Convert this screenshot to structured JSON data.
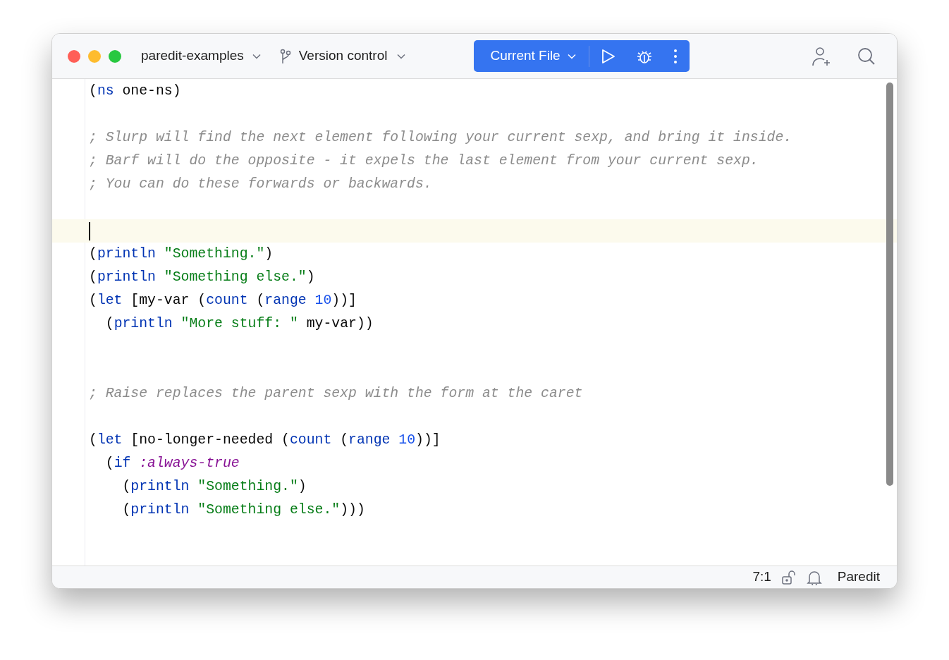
{
  "window": {
    "project": "paredit-examples",
    "vcs": "Version control",
    "run_config": "Current File"
  },
  "editor": {
    "lines": [
      {
        "kind": "code",
        "tokens": [
          {
            "kind": "plain",
            "text": "("
          },
          {
            "kind": "keyword",
            "text": "ns"
          },
          {
            "kind": "plain",
            "text": " one-ns)"
          }
        ]
      },
      {
        "kind": "blank"
      },
      {
        "kind": "code",
        "tokens": [
          {
            "kind": "comment",
            "text": "; Slurp will find the next element following your current sexp, and bring it inside."
          }
        ]
      },
      {
        "kind": "code",
        "tokens": [
          {
            "kind": "comment",
            "text": "; Barf will do the opposite - it expels the last element from your current sexp."
          }
        ]
      },
      {
        "kind": "code",
        "tokens": [
          {
            "kind": "comment",
            "text": "; You can do these forwards or backwards."
          }
        ]
      },
      {
        "kind": "blank"
      },
      {
        "kind": "caret"
      },
      {
        "kind": "code",
        "tokens": [
          {
            "kind": "plain",
            "text": "("
          },
          {
            "kind": "keyword",
            "text": "println"
          },
          {
            "kind": "string",
            "text": " \"Something.\""
          },
          {
            "kind": "plain",
            "text": ")"
          }
        ]
      },
      {
        "kind": "code",
        "tokens": [
          {
            "kind": "plain",
            "text": "("
          },
          {
            "kind": "keyword",
            "text": "println"
          },
          {
            "kind": "string",
            "text": " \"Something else.\""
          },
          {
            "kind": "plain",
            "text": ")"
          }
        ]
      },
      {
        "kind": "code",
        "tokens": [
          {
            "kind": "plain",
            "text": "("
          },
          {
            "kind": "keyword",
            "text": "let"
          },
          {
            "kind": "plain",
            "text": " [my-var ("
          },
          {
            "kind": "keyword",
            "text": "count"
          },
          {
            "kind": "plain",
            "text": " ("
          },
          {
            "kind": "keyword",
            "text": "range"
          },
          {
            "kind": "number",
            "text": " 10"
          },
          {
            "kind": "plain",
            "text": "))]"
          }
        ]
      },
      {
        "kind": "code",
        "tokens": [
          {
            "kind": "plain",
            "text": "  ("
          },
          {
            "kind": "keyword",
            "text": "println"
          },
          {
            "kind": "string",
            "text": " \"More stuff: \""
          },
          {
            "kind": "plain",
            "text": " my-var))"
          }
        ]
      },
      {
        "kind": "blank"
      },
      {
        "kind": "blank"
      },
      {
        "kind": "code",
        "tokens": [
          {
            "kind": "comment",
            "text": "; Raise replaces the parent sexp with the form at the caret"
          }
        ]
      },
      {
        "kind": "blank"
      },
      {
        "kind": "code",
        "tokens": [
          {
            "kind": "plain",
            "text": "("
          },
          {
            "kind": "keyword",
            "text": "let"
          },
          {
            "kind": "plain",
            "text": " [no-longer-needed ("
          },
          {
            "kind": "keyword",
            "text": "count"
          },
          {
            "kind": "plain",
            "text": " ("
          },
          {
            "kind": "keyword",
            "text": "range"
          },
          {
            "kind": "number",
            "text": " 10"
          },
          {
            "kind": "plain",
            "text": "))]"
          }
        ]
      },
      {
        "kind": "code",
        "tokens": [
          {
            "kind": "plain",
            "text": "  ("
          },
          {
            "kind": "keyword",
            "text": "if"
          },
          {
            "kind": "literal",
            "text": " :always-true"
          }
        ]
      },
      {
        "kind": "code",
        "tokens": [
          {
            "kind": "plain",
            "text": "    ("
          },
          {
            "kind": "keyword",
            "text": "println"
          },
          {
            "kind": "string",
            "text": " \"Something.\""
          },
          {
            "kind": "plain",
            "text": ")"
          }
        ]
      },
      {
        "kind": "code",
        "tokens": [
          {
            "kind": "plain",
            "text": "    ("
          },
          {
            "kind": "keyword",
            "text": "println"
          },
          {
            "kind": "string",
            "text": " \"Something else.\""
          },
          {
            "kind": "plain",
            "text": ")))"
          }
        ]
      }
    ]
  },
  "status_bar": {
    "position": "7:1",
    "mode": "Paredit"
  }
}
